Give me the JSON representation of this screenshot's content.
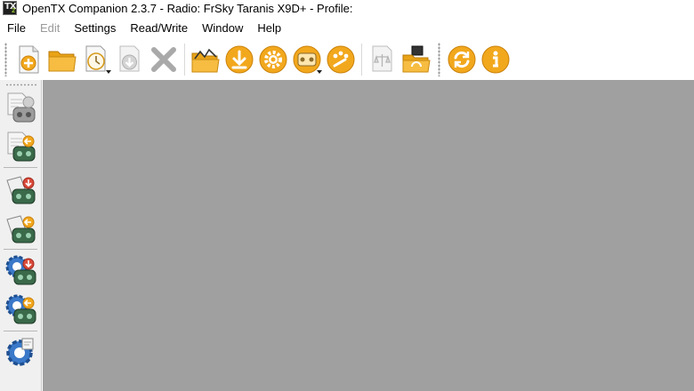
{
  "window": {
    "title": "OpenTX Companion 2.3.7 - Radio: FrSky Taranis X9D+ - Profile:",
    "icon": "opentx-app-icon",
    "icon_text": "TX"
  },
  "menu": [
    {
      "label": "File",
      "enabled": true
    },
    {
      "label": "Edit",
      "enabled": false
    },
    {
      "label": "Settings",
      "enabled": true
    },
    {
      "label": "Read/Write",
      "enabled": true
    },
    {
      "label": "Window",
      "enabled": true
    },
    {
      "label": "Help",
      "enabled": true
    }
  ],
  "toolbar": {
    "groups": [
      [
        "new-document-icon",
        "open-folder-icon",
        "recent-files-icon",
        "save-icon",
        "close-x-icon"
      ],
      [
        "open-logs-icon",
        "download-icon",
        "gear-icon",
        "radio-profile-icon",
        "palette-icon"
      ],
      [
        "compare-icon",
        "sd-sync-icon"
      ],
      [
        "update-check-icon",
        "info-icon"
      ]
    ]
  },
  "sidebar": {
    "buttons": [
      "read-models-from-radio-icon",
      "write-models-to-radio-icon",
      "read-firmware-from-radio-icon",
      "write-firmware-to-radio-icon",
      "backup-radio-icon",
      "restore-radio-icon",
      "radio-settings-icon"
    ]
  },
  "colors": {
    "accent_orange": "#f2a81d",
    "mdi_background": "#a0a0a0",
    "radio_green": "#3a6a4a",
    "gear_blue": "#3b79c9"
  }
}
